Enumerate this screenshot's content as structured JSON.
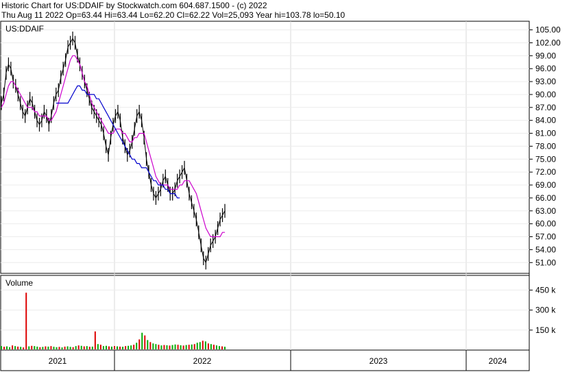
{
  "header": {
    "line1": "Historic Chart for US:DDAIF by Stockwatch.com 604.687.1500 - (c) 2022",
    "line2": "Thu Aug 11 2022   Op=63.44   Hi=63.44   Lo=62.20   Cl=62.22   Vol=25,093   Year hi=103.78   lo=50.10"
  },
  "chart_data": [
    {
      "type": "line",
      "title": "US:DDAIF",
      "y_ticks": [
        "105.00",
        "102.00",
        "99.00",
        "96.00",
        "93.00",
        "90.00",
        "87.00",
        "84.00",
        "81.00",
        "78.00",
        "75.00",
        "72.00",
        "69.00",
        "66.00",
        "63.00",
        "60.00",
        "57.00",
        "54.00",
        "51.00"
      ],
      "ylim": [
        48.5,
        107
      ],
      "x_labels": [
        "2021",
        "2022",
        "2023",
        "2024"
      ],
      "grid": true,
      "series": [
        {
          "color": "#000000",
          "values": [
            88,
            90,
            95,
            97,
            96,
            93,
            92,
            90,
            88,
            86,
            85,
            87,
            89,
            88,
            86,
            84,
            83,
            84,
            86,
            85,
            83,
            85,
            88,
            90,
            91,
            94,
            96,
            98,
            101,
            102,
            103,
            102,
            99,
            97,
            95,
            93,
            91,
            89,
            87,
            86,
            85,
            84,
            83,
            81,
            78,
            76,
            80,
            83,
            85,
            86,
            84,
            80,
            78,
            76,
            77,
            79,
            82,
            85,
            86,
            84,
            80,
            75,
            72,
            69,
            67,
            66,
            67,
            68,
            70,
            71,
            69,
            67,
            67,
            68,
            70,
            71,
            72,
            73,
            70,
            67,
            65,
            63,
            61,
            58,
            55,
            52,
            51,
            53,
            55,
            56,
            57,
            59,
            61,
            62,
            63
          ]
        },
        {
          "color": "#cc00cc",
          "values": [
            87,
            88,
            90,
            92,
            93,
            93,
            92,
            91,
            90,
            89,
            88,
            87,
            87,
            87,
            86,
            86,
            85,
            85,
            85,
            85,
            84,
            84,
            85,
            86,
            88,
            90,
            92,
            94,
            96,
            98,
            99,
            99,
            98,
            97,
            95,
            93,
            92,
            90,
            88,
            87,
            86,
            85,
            84,
            83,
            82,
            81,
            81,
            81,
            82,
            82,
            82,
            81,
            81,
            80,
            79,
            79,
            80,
            80,
            81,
            81,
            81,
            79,
            77,
            75,
            73,
            71,
            70,
            69,
            69,
            69,
            69,
            68,
            68,
            68,
            68,
            69,
            69,
            70,
            70,
            70,
            69,
            68,
            67,
            65,
            63,
            61,
            59,
            58,
            57,
            57,
            57,
            57,
            57,
            58,
            58
          ]
        },
        {
          "color": "#0000cc",
          "values": [
            null,
            null,
            null,
            null,
            null,
            null,
            null,
            null,
            null,
            null,
            null,
            null,
            null,
            null,
            null,
            null,
            null,
            null,
            null,
            null,
            null,
            null,
            null,
            88,
            88,
            88,
            88,
            88,
            88,
            89,
            90,
            91,
            92,
            92,
            91,
            91,
            90,
            90,
            90,
            90,
            89,
            89,
            88,
            87,
            86,
            85,
            84,
            83,
            82,
            81,
            80,
            79,
            78,
            77,
            76,
            75,
            75,
            74,
            74,
            73,
            73,
            73,
            72,
            71,
            70,
            70,
            69,
            69,
            69,
            68,
            68,
            67,
            67,
            67,
            66,
            66
          ]
        }
      ]
    },
    {
      "type": "bar",
      "title": "Volume",
      "y_ticks": [
        "450 k",
        "300 k",
        "150 k"
      ],
      "ylim": [
        0,
        560000
      ],
      "colors": {
        "up": "#00aa00",
        "down": "#dd0000"
      },
      "values": [
        30000,
        25000,
        28000,
        22000,
        35000,
        30000,
        26000,
        24000,
        20000,
        430000,
        28000,
        32000,
        30000,
        26000,
        22000,
        24000,
        28000,
        26000,
        30000,
        25000,
        22000,
        24000,
        20000,
        26000,
        28000,
        24000,
        22000,
        30000,
        35000,
        32000,
        28000,
        30000,
        25000,
        26000,
        140000,
        45000,
        40000,
        30000,
        32000,
        28000,
        26000,
        30000,
        28000,
        26000,
        25000,
        30000,
        32000,
        35000,
        40000,
        55000,
        80000,
        130000,
        110000,
        75000,
        60000,
        50000,
        45000,
        40000,
        35000,
        38000,
        36000,
        34000,
        38000,
        42000,
        40000,
        36000,
        34000,
        38000,
        40000,
        42000,
        45000,
        55000,
        60000,
        70000,
        65000,
        50000,
        45000,
        40000,
        35000,
        30000,
        28000,
        25000
      ],
      "up": [
        true,
        false,
        true,
        true,
        false,
        true,
        false,
        true,
        false,
        false,
        true,
        false,
        true,
        true,
        false,
        true,
        false,
        true,
        false,
        true,
        true,
        false,
        true,
        false,
        true,
        true,
        false,
        true,
        false,
        true,
        false,
        true,
        false,
        true,
        false,
        true,
        false,
        true,
        true,
        false,
        true,
        false,
        true,
        false,
        true,
        false,
        true,
        true,
        false,
        true,
        false,
        true,
        false,
        true,
        false,
        true,
        true,
        false,
        true,
        false,
        true,
        false,
        true,
        true,
        false,
        true,
        false,
        true,
        false,
        true,
        false,
        true,
        true,
        false,
        true,
        false,
        true,
        false,
        true,
        true,
        false,
        true
      ]
    }
  ]
}
